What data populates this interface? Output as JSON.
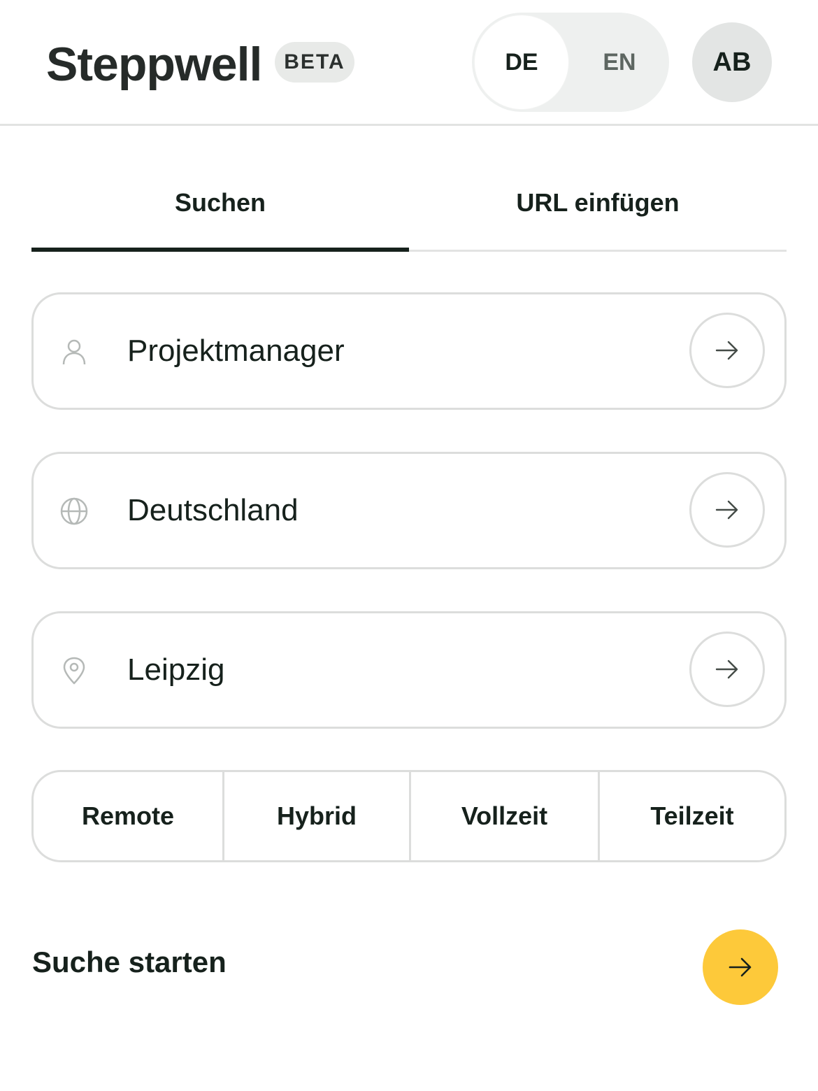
{
  "header": {
    "logo": "Steppwell",
    "badge": "BETA",
    "languages": [
      "DE",
      "EN"
    ],
    "active_language": "DE",
    "avatar_initials": "AB"
  },
  "tabs": [
    {
      "label": "Suchen",
      "active": true
    },
    {
      "label": "URL einfügen",
      "active": false
    }
  ],
  "search": {
    "fields": [
      {
        "icon": "person-icon",
        "value": "Projektmanager"
      },
      {
        "icon": "globe-icon",
        "value": "Deutschland"
      },
      {
        "icon": "location-pin-icon",
        "value": "Leipzig"
      }
    ],
    "filters": [
      "Remote",
      "Hybrid",
      "Vollzeit",
      "Teilzeit"
    ],
    "submit_label": "Suche starten"
  },
  "colors": {
    "accent": "#fdc93a",
    "text": "#16211c",
    "border": "#dcdddc"
  }
}
